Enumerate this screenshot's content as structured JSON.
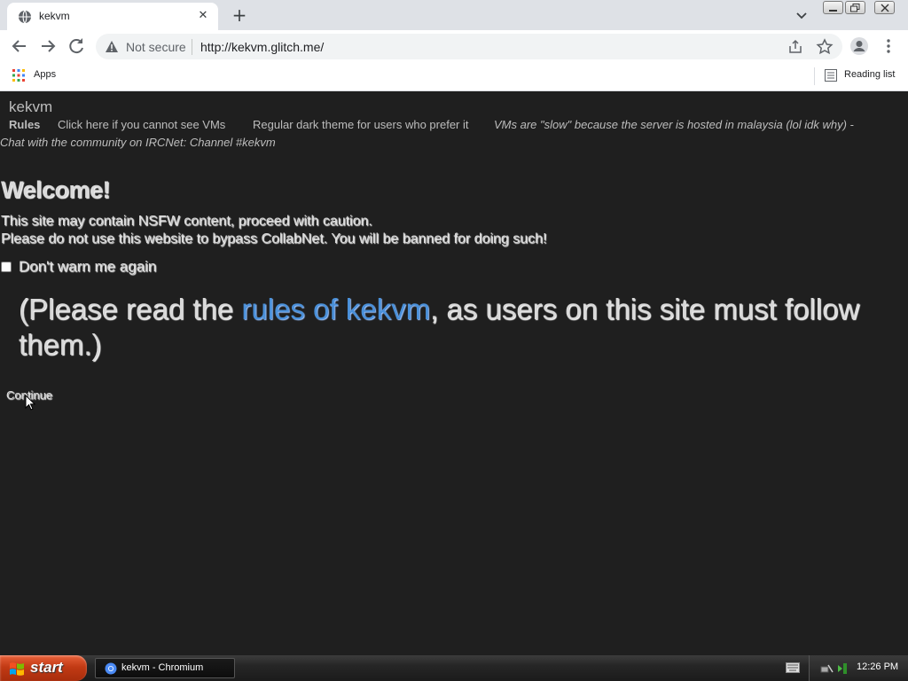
{
  "browser": {
    "tab_title": "kekvm",
    "security_label": "Not secure",
    "url": "http://kekvm.glitch.me/",
    "bookmarks": {
      "apps_label": "Apps",
      "reading_list_label": "Reading list"
    }
  },
  "site": {
    "title": "kekvm",
    "nav": {
      "rules": "Rules",
      "cannot_see": "Click here if you cannot see VMs",
      "dark_theme": "Regular dark theme for users who prefer it",
      "slow_note": "VMs are \"slow\" because the server is hosted in malaysia (lol idk why) -",
      "chat": "Chat with the community on IRCNet: Channel #kekvm"
    },
    "welcome": {
      "heading": "Welcome!",
      "line1": "This site may contain NSFW content, proceed with caution.",
      "line2": "Please do not use this website to bypass CollabNet. You will be banned for doing such!",
      "checkbox_label": "Don't warn me again",
      "checkbox_checked": false,
      "notice_prefix": "(Please read the ",
      "notice_link": "rules of kekvm",
      "notice_suffix": ", as users on this site must follow them.)",
      "continue_label": "Continue"
    }
  },
  "taskbar": {
    "start_label": "start",
    "task_label": "kekvm - Chromium",
    "clock": "12:26 PM"
  },
  "colors": {
    "page_bg": "#1f1f1f",
    "link": "#4a90d9",
    "start_button": "#c23a14"
  }
}
